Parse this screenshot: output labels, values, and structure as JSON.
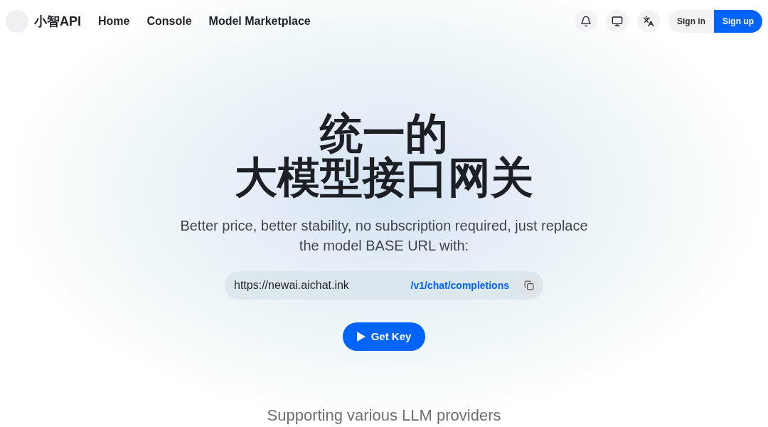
{
  "brand": {
    "name": "小智API"
  },
  "nav": [
    {
      "label": "Home"
    },
    {
      "label": "Console"
    },
    {
      "label": "Model Marketplace"
    }
  ],
  "header_actions": {
    "sign_in": "Sign in",
    "sign_up": "Sign up"
  },
  "hero": {
    "title_lines": [
      "统一的",
      "大模型接口网关"
    ],
    "subtitle": "Better price, better stability, no subscription required, just replace the model BASE URL with:",
    "base_url": "https://newai.aichat.ink",
    "endpoint": "/v1/chat/completions",
    "cta": "Get Key"
  },
  "providers": {
    "heading": "Supporting various LLM providers"
  }
}
